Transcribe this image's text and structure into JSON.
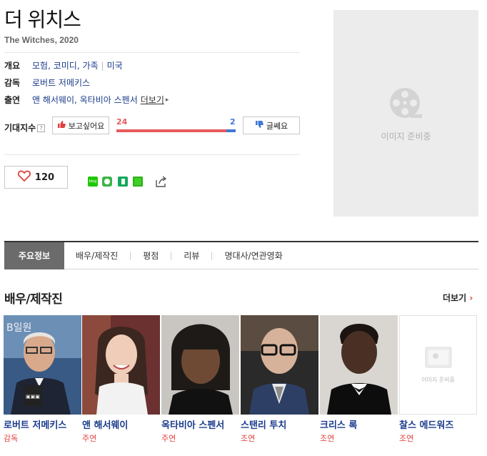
{
  "movie": {
    "title": "더 위치스",
    "subtitle": "The Witches, 2020"
  },
  "info": {
    "overview_label": "개요",
    "genres": "모험, 코미디, 가족",
    "country": "미국",
    "director_label": "감독",
    "director": "로버트 저메키스",
    "cast_label": "출연",
    "cast": "앤 해서웨이, 옥타비아 스펜서",
    "more": "더보기",
    "more_icon": "chevron-right-icon"
  },
  "expectation": {
    "label": "기대지수",
    "help_icon": "question-icon",
    "want_label": "보고싶어요",
    "meh_label": "글쎄요",
    "want_count": "24",
    "meh_count": "2",
    "want_ratio": 0.92,
    "colors": {
      "want": "#e85a5c",
      "meh": "#3f78d8"
    }
  },
  "like": {
    "count": "120",
    "icon": "heart-icon"
  },
  "share": {
    "icons": [
      "blog-icon",
      "band-icon",
      "bookmark-icon",
      "line-icon",
      "share-icon"
    ],
    "blog_text": "blog"
  },
  "poster": {
    "placeholder": "이미지 준비중",
    "icon": "film-reel-icon"
  },
  "tabs": [
    {
      "label": "주요정보",
      "active": true
    },
    {
      "label": "배우/제작진"
    },
    {
      "label": "평점"
    },
    {
      "label": "리뷰"
    },
    {
      "label": "명대사/연관영화"
    }
  ],
  "cast_section": {
    "title": "배우/제작진",
    "more": "더보기",
    "members": [
      {
        "name": "로버트 저메키스",
        "role": "감독"
      },
      {
        "name": "앤 해서웨이",
        "role": "주연"
      },
      {
        "name": "옥타비아 스펜서",
        "role": "주연"
      },
      {
        "name": "스탠리 투치",
        "role": "조연"
      },
      {
        "name": "크리스 록",
        "role": "조연"
      },
      {
        "name": "찰스 에드워즈",
        "role": "조연"
      }
    ],
    "noimg_placeholder": "이미지 준비중",
    "photo_sign_text": "B일원"
  },
  "accent_color": "#1a3b8c"
}
